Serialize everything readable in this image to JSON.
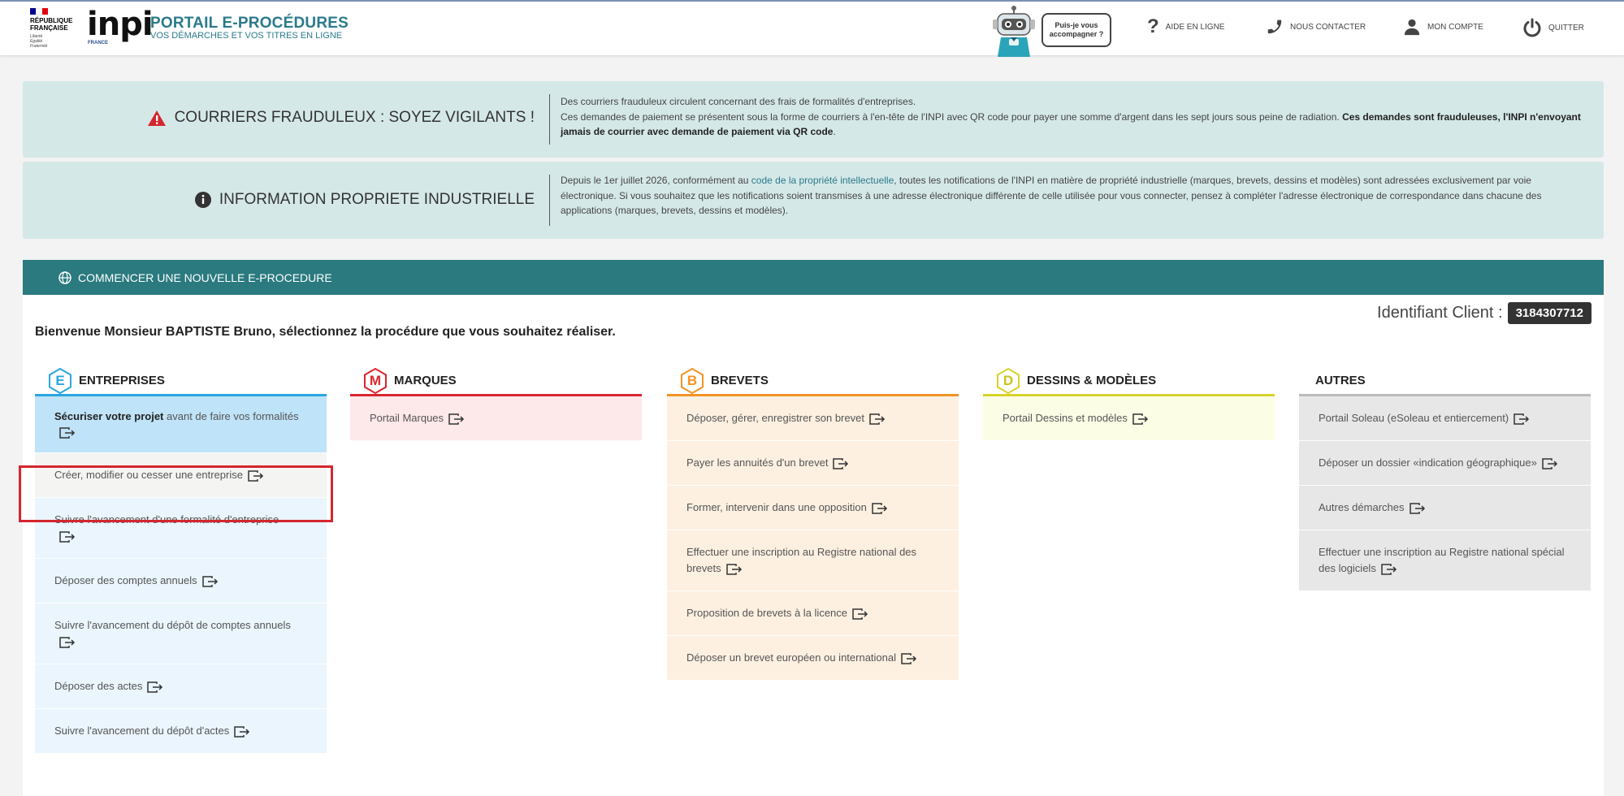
{
  "header": {
    "republique": [
      "RÉPUBLIQUE",
      "FRANÇAISE"
    ],
    "devise": [
      "Liberté",
      "Égalité",
      "Fraternité"
    ],
    "inpi_logo": "inpi",
    "inpi_country": "FRANCE",
    "portal_title": "PORTAIL E-PROCÉDURES",
    "portal_subtitle": "VOS DÉMARCHES ET VOS TITRES EN LIGNE",
    "bubble": "Puis-je vous accompagner ?",
    "nav": [
      {
        "label": "AIDE EN LIGNE",
        "icon": "question-icon"
      },
      {
        "label": "NOUS CONTACTER",
        "icon": "phone-icon"
      },
      {
        "label": "MON COMPTE",
        "icon": "user-icon"
      },
      {
        "label": "QUITTER",
        "icon": "power-icon"
      }
    ]
  },
  "alerts": {
    "fraud": {
      "title": "COURRIERS FRAUDULEUX : SOYEZ VIGILANTS !",
      "line1": "Des courriers frauduleux circulent concernant des frais de formalités d'entreprises.",
      "line2": "Ces demandes de paiement se présentent sous la forme de courriers à l'en-tête de l'INPI avec QR code pour payer une somme d'argent dans les sept jours sous peine de radiation. ",
      "line2_bold": "Ces demandes sont frauduleuses, l'INPI n'envoyant jamais de courrier avec demande de paiement via QR code",
      "line2_end": "."
    },
    "info": {
      "title": "INFORMATION PROPRIETE INDUSTRIELLE",
      "text_before": "Depuis le 1er juillet 2026, conformément au ",
      "link": "code de la propriété intellectuelle",
      "text_after": ", toutes les notifications de l'INPI en matière de propriété industrielle (marques, brevets, dessins et modèles) sont adressées exclusivement par voie électronique. Si vous souhaitez que les notifications soient transmises à une adresse électronique différente de celle utilisée pour vous connecter, pensez à compléter l'adresse électronique de correspondance dans chacune des applications (marques, brevets, dessins et modèles)."
    }
  },
  "panel": {
    "title": "COMMENCER UNE NOUVELLE E-PROCEDURE",
    "client_label": "Identifiant Client :",
    "client_id": "3184307712",
    "welcome": "Bienvenue Monsieur BAPTISTE Bruno, sélectionnez la procédure que vous souhaitez réaliser."
  },
  "columns": {
    "entreprises": {
      "letter": "E",
      "title": "ENTREPRISES",
      "color": "#29a6e0",
      "bg": "#e8f4fc",
      "first_bold": "Sécuriser votre projet",
      "first_rest": " avant de faire vos formalités",
      "items": [
        "Créer, modifier ou cesser une entreprise",
        "Suivre l'avancement d'une formalité d'entreprise",
        "Déposer des comptes annuels",
        "Suivre l'avancement du dépôt de comptes annuels",
        "Déposer des actes",
        "Suivre l'avancement du dépôt d'actes"
      ]
    },
    "marques": {
      "letter": "M",
      "title": "MARQUES",
      "color": "#d9262e",
      "bg": "#fde8ea",
      "items": [
        "Portail Marques"
      ]
    },
    "brevets": {
      "letter": "B",
      "title": "BREVETS",
      "color": "#f39325",
      "bg": "#fdf0e1",
      "items": [
        "Déposer, gérer, enregistrer son brevet",
        "Payer les annuités d'un brevet",
        "Former, intervenir dans une opposition",
        "Effectuer une inscription au Registre national des brevets",
        "Proposition de brevets à la licence",
        "Déposer un brevet européen ou international"
      ]
    },
    "dessins": {
      "letter": "D",
      "title": "DESSINS & MODÈLES",
      "color": "#d7d22a",
      "bg": "#fbfde5",
      "items": [
        "Portail Dessins et modèles"
      ]
    },
    "autres": {
      "title": "AUTRES",
      "color": "#bbbbbb",
      "bg": "#e7e7e7",
      "items": [
        "Portail Soleau (eSoleau et entiercement)",
        "Déposer un dossier «indication géographique»",
        "Autres démarches",
        "Effectuer une inscription au Registre national spécial des logiciels"
      ]
    }
  }
}
